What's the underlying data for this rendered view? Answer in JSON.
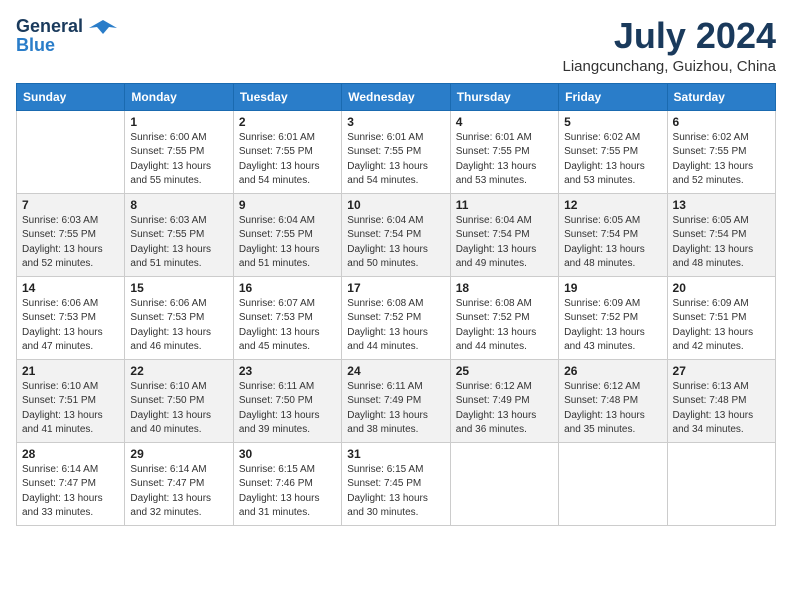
{
  "logo": {
    "general": "General",
    "blue": "Blue",
    "tagline": ""
  },
  "title": "July 2024",
  "location": "Liangcunchang, Guizhou, China",
  "days_of_week": [
    "Sunday",
    "Monday",
    "Tuesday",
    "Wednesday",
    "Thursday",
    "Friday",
    "Saturday"
  ],
  "weeks": [
    [
      {
        "day": "",
        "sunrise": "",
        "sunset": "",
        "daylight": ""
      },
      {
        "day": "1",
        "sunrise": "Sunrise: 6:00 AM",
        "sunset": "Sunset: 7:55 PM",
        "daylight": "Daylight: 13 hours and 55 minutes."
      },
      {
        "day": "2",
        "sunrise": "Sunrise: 6:01 AM",
        "sunset": "Sunset: 7:55 PM",
        "daylight": "Daylight: 13 hours and 54 minutes."
      },
      {
        "day": "3",
        "sunrise": "Sunrise: 6:01 AM",
        "sunset": "Sunset: 7:55 PM",
        "daylight": "Daylight: 13 hours and 54 minutes."
      },
      {
        "day": "4",
        "sunrise": "Sunrise: 6:01 AM",
        "sunset": "Sunset: 7:55 PM",
        "daylight": "Daylight: 13 hours and 53 minutes."
      },
      {
        "day": "5",
        "sunrise": "Sunrise: 6:02 AM",
        "sunset": "Sunset: 7:55 PM",
        "daylight": "Daylight: 13 hours and 53 minutes."
      },
      {
        "day": "6",
        "sunrise": "Sunrise: 6:02 AM",
        "sunset": "Sunset: 7:55 PM",
        "daylight": "Daylight: 13 hours and 52 minutes."
      }
    ],
    [
      {
        "day": "7",
        "sunrise": "Sunrise: 6:03 AM",
        "sunset": "Sunset: 7:55 PM",
        "daylight": "Daylight: 13 hours and 52 minutes."
      },
      {
        "day": "8",
        "sunrise": "Sunrise: 6:03 AM",
        "sunset": "Sunset: 7:55 PM",
        "daylight": "Daylight: 13 hours and 51 minutes."
      },
      {
        "day": "9",
        "sunrise": "Sunrise: 6:04 AM",
        "sunset": "Sunset: 7:55 PM",
        "daylight": "Daylight: 13 hours and 51 minutes."
      },
      {
        "day": "10",
        "sunrise": "Sunrise: 6:04 AM",
        "sunset": "Sunset: 7:54 PM",
        "daylight": "Daylight: 13 hours and 50 minutes."
      },
      {
        "day": "11",
        "sunrise": "Sunrise: 6:04 AM",
        "sunset": "Sunset: 7:54 PM",
        "daylight": "Daylight: 13 hours and 49 minutes."
      },
      {
        "day": "12",
        "sunrise": "Sunrise: 6:05 AM",
        "sunset": "Sunset: 7:54 PM",
        "daylight": "Daylight: 13 hours and 48 minutes."
      },
      {
        "day": "13",
        "sunrise": "Sunrise: 6:05 AM",
        "sunset": "Sunset: 7:54 PM",
        "daylight": "Daylight: 13 hours and 48 minutes."
      }
    ],
    [
      {
        "day": "14",
        "sunrise": "Sunrise: 6:06 AM",
        "sunset": "Sunset: 7:53 PM",
        "daylight": "Daylight: 13 hours and 47 minutes."
      },
      {
        "day": "15",
        "sunrise": "Sunrise: 6:06 AM",
        "sunset": "Sunset: 7:53 PM",
        "daylight": "Daylight: 13 hours and 46 minutes."
      },
      {
        "day": "16",
        "sunrise": "Sunrise: 6:07 AM",
        "sunset": "Sunset: 7:53 PM",
        "daylight": "Daylight: 13 hours and 45 minutes."
      },
      {
        "day": "17",
        "sunrise": "Sunrise: 6:08 AM",
        "sunset": "Sunset: 7:52 PM",
        "daylight": "Daylight: 13 hours and 44 minutes."
      },
      {
        "day": "18",
        "sunrise": "Sunrise: 6:08 AM",
        "sunset": "Sunset: 7:52 PM",
        "daylight": "Daylight: 13 hours and 44 minutes."
      },
      {
        "day": "19",
        "sunrise": "Sunrise: 6:09 AM",
        "sunset": "Sunset: 7:52 PM",
        "daylight": "Daylight: 13 hours and 43 minutes."
      },
      {
        "day": "20",
        "sunrise": "Sunrise: 6:09 AM",
        "sunset": "Sunset: 7:51 PM",
        "daylight": "Daylight: 13 hours and 42 minutes."
      }
    ],
    [
      {
        "day": "21",
        "sunrise": "Sunrise: 6:10 AM",
        "sunset": "Sunset: 7:51 PM",
        "daylight": "Daylight: 13 hours and 41 minutes."
      },
      {
        "day": "22",
        "sunrise": "Sunrise: 6:10 AM",
        "sunset": "Sunset: 7:50 PM",
        "daylight": "Daylight: 13 hours and 40 minutes."
      },
      {
        "day": "23",
        "sunrise": "Sunrise: 6:11 AM",
        "sunset": "Sunset: 7:50 PM",
        "daylight": "Daylight: 13 hours and 39 minutes."
      },
      {
        "day": "24",
        "sunrise": "Sunrise: 6:11 AM",
        "sunset": "Sunset: 7:49 PM",
        "daylight": "Daylight: 13 hours and 38 minutes."
      },
      {
        "day": "25",
        "sunrise": "Sunrise: 6:12 AM",
        "sunset": "Sunset: 7:49 PM",
        "daylight": "Daylight: 13 hours and 36 minutes."
      },
      {
        "day": "26",
        "sunrise": "Sunrise: 6:12 AM",
        "sunset": "Sunset: 7:48 PM",
        "daylight": "Daylight: 13 hours and 35 minutes."
      },
      {
        "day": "27",
        "sunrise": "Sunrise: 6:13 AM",
        "sunset": "Sunset: 7:48 PM",
        "daylight": "Daylight: 13 hours and 34 minutes."
      }
    ],
    [
      {
        "day": "28",
        "sunrise": "Sunrise: 6:14 AM",
        "sunset": "Sunset: 7:47 PM",
        "daylight": "Daylight: 13 hours and 33 minutes."
      },
      {
        "day": "29",
        "sunrise": "Sunrise: 6:14 AM",
        "sunset": "Sunset: 7:47 PM",
        "daylight": "Daylight: 13 hours and 32 minutes."
      },
      {
        "day": "30",
        "sunrise": "Sunrise: 6:15 AM",
        "sunset": "Sunset: 7:46 PM",
        "daylight": "Daylight: 13 hours and 31 minutes."
      },
      {
        "day": "31",
        "sunrise": "Sunrise: 6:15 AM",
        "sunset": "Sunset: 7:45 PM",
        "daylight": "Daylight: 13 hours and 30 minutes."
      },
      {
        "day": "",
        "sunrise": "",
        "sunset": "",
        "daylight": ""
      },
      {
        "day": "",
        "sunrise": "",
        "sunset": "",
        "daylight": ""
      },
      {
        "day": "",
        "sunrise": "",
        "sunset": "",
        "daylight": ""
      }
    ]
  ]
}
